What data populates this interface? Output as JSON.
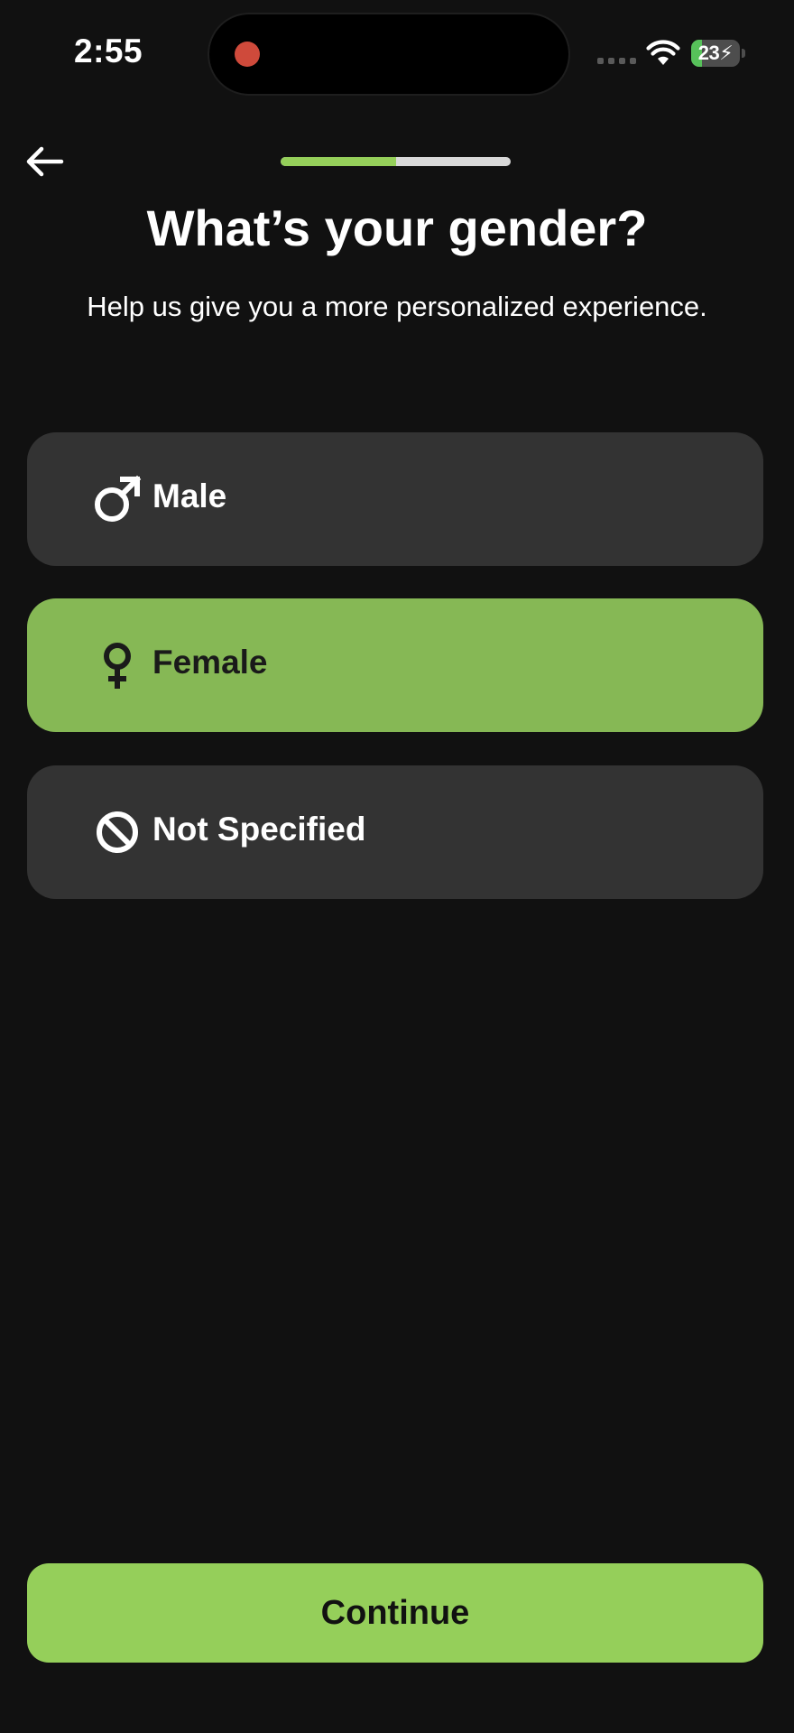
{
  "status_bar": {
    "time": "2:55",
    "battery_percent": "23"
  },
  "header": {
    "progress_fraction": 0.5,
    "title": "What’s your gender?",
    "subtitle": "Help us give you a more personalized experience."
  },
  "options": [
    {
      "label": "Male",
      "icon": "male-symbol-icon",
      "selected": false
    },
    {
      "label": "Female",
      "icon": "female-symbol-icon",
      "selected": true
    },
    {
      "label": "Not Specified",
      "icon": "prohibited-icon",
      "selected": false
    }
  ],
  "footer": {
    "continue_label": "Continue"
  },
  "colors": {
    "background": "#111111",
    "accent": "#95cf5a",
    "selected_option": "#86b855",
    "option_background": "#333333",
    "record_indicator": "#cf4a3b"
  }
}
